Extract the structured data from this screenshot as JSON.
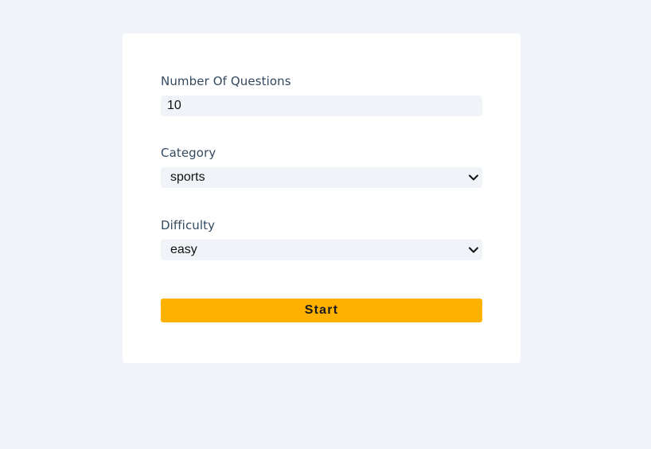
{
  "form": {
    "questions": {
      "label": "Number Of Questions",
      "value": "10"
    },
    "category": {
      "label": "Category",
      "selected": "sports"
    },
    "difficulty": {
      "label": "Difficulty",
      "selected": "easy"
    },
    "start_label": "Start"
  },
  "colors": {
    "page_background": "#f0f4f8",
    "card_background": "#ffffff",
    "label_text": "#334a61",
    "input_background": "#f0f4f8",
    "button_background": "#ffb100"
  },
  "icons": {
    "select_arrow": "chevron-down-icon"
  }
}
